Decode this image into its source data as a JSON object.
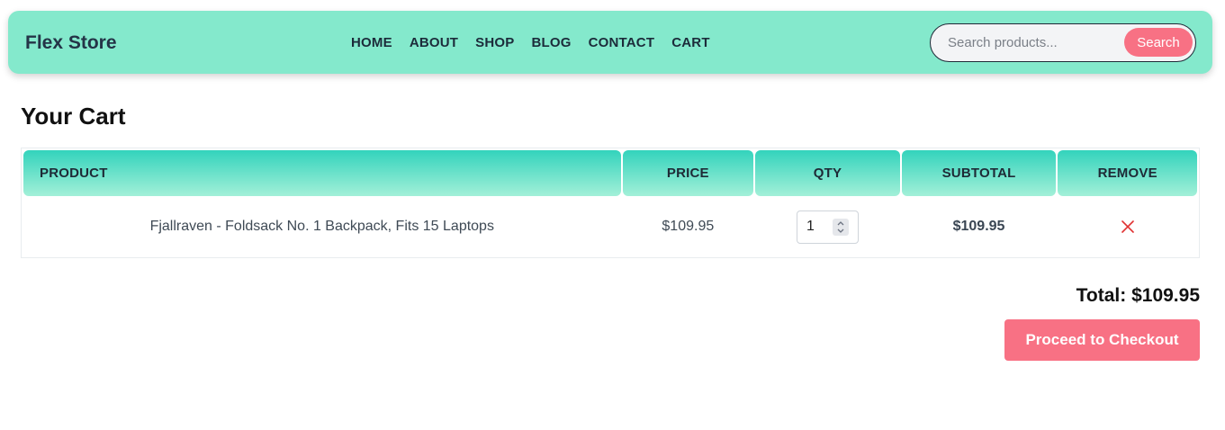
{
  "header": {
    "brand": "Flex Store",
    "nav": [
      "HOME",
      "ABOUT",
      "SHOP",
      "BLOG",
      "CONTACT",
      "CART"
    ],
    "search": {
      "placeholder": "Search products...",
      "button_label": "Search"
    }
  },
  "page_title": "Your Cart",
  "table": {
    "columns": [
      "PRODUCT",
      "PRICE",
      "QTY",
      "SUBTOTAL",
      "REMOVE"
    ],
    "rows": [
      {
        "product": "Fjallraven - Foldsack No. 1 Backpack, Fits 15 Laptops",
        "price": "$109.95",
        "qty": "1",
        "subtotal": "$109.95",
        "remove_icon": "close-icon"
      }
    ]
  },
  "total": "Total: $109.95",
  "checkout_label": "Proceed to Checkout",
  "colors": {
    "navbar": "#84e9cc",
    "accent": "#f87184",
    "table_header_top": "#33d3bc",
    "table_header_bottom": "#a3f0d8",
    "remove_icon": "#e03131"
  }
}
